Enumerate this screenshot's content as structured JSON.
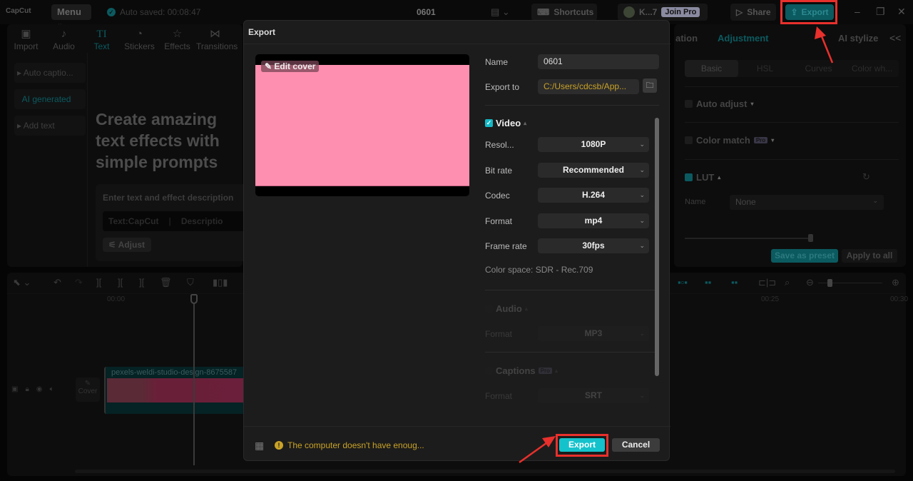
{
  "topbar": {
    "logo": "CapCut",
    "menu_label": "Menu",
    "autosave_text": "Auto saved: 00:08:47",
    "project_title": "0601",
    "shortcuts_label": "Shortcuts",
    "username": "K...7",
    "join_pro_label": "Join Pro",
    "share_label": "Share",
    "export_label": "Export"
  },
  "media_toolbar": {
    "items": [
      {
        "label": "Import",
        "icon": "import-icon"
      },
      {
        "label": "Audio",
        "icon": "audio-icon"
      },
      {
        "label": "Text",
        "icon": "text-icon",
        "active": true
      },
      {
        "label": "Stickers",
        "icon": "stickers-icon"
      },
      {
        "label": "Effects",
        "icon": "effects-icon"
      },
      {
        "label": "Transitions",
        "icon": "transitions-icon"
      }
    ]
  },
  "text_sidebar": {
    "items": [
      {
        "label": "Auto captio..."
      },
      {
        "label": "AI generated",
        "active": true
      },
      {
        "label": "Add text"
      }
    ]
  },
  "ai_text": {
    "hero_line1": "Create amazing",
    "hero_line2": "text effects with",
    "hero_line3": "simple prompts",
    "prompt_label": "Enter text and effect description",
    "text_placeholder": "Text:CapCut",
    "desc_placeholder": "Descriptio",
    "adjust_label": "Adjust"
  },
  "right_panel": {
    "tab_partial": "ation",
    "tab_adjustment": "Adjustment",
    "tab_ai_stylize": "AI stylize",
    "collapse_icon": "<<",
    "subtabs": [
      "Basic",
      "HSL",
      "Curves",
      "Color wh..."
    ],
    "auto_adjust_label": "Auto adjust",
    "color_match_label": "Color match",
    "lut_label": "LUT",
    "lut_name_label": "Name",
    "lut_name_value": "None",
    "save_preset_label": "Save as preset",
    "apply_all_label": "Apply to all",
    "pro_badge": "Pro"
  },
  "timeline": {
    "ruler_ticks": [
      "00:00",
      "00:25",
      "00:30"
    ],
    "clip_name": "pexels-weldi-studio-design-8675587",
    "cover_label": "Cover"
  },
  "export_dialog": {
    "title": "Export",
    "edit_cover_label": "Edit cover",
    "name_label": "Name",
    "name_value": "0601",
    "export_to_label": "Export to",
    "export_to_value": "C:/Users/cdcsb/App...",
    "video_section": "Video",
    "video_enabled": true,
    "resolution_label": "Resol...",
    "resolution_value": "1080P",
    "bitrate_label": "Bit rate",
    "bitrate_value": "Recommended",
    "codec_label": "Codec",
    "codec_value": "H.264",
    "format_label": "Format",
    "format_value": "mp4",
    "framerate_label": "Frame rate",
    "framerate_value": "30fps",
    "color_space": "Color space: SDR - Rec.709",
    "audio_section": "Audio",
    "audio_enabled": false,
    "audio_format_label": "Format",
    "audio_format_value": "MP3",
    "captions_section": "Captions",
    "captions_enabled": false,
    "captions_pro_badge": "Pro",
    "captions_format_label": "Format",
    "captions_format_value": "SRT",
    "warning_text": "The computer doesn't have enoug...",
    "export_label": "Export",
    "cancel_label": "Cancel"
  },
  "colors": {
    "accent": "#14c2cc",
    "annotation": "#e8302c",
    "preview_fill": "#fe8fb0",
    "warning": "#c9a227"
  }
}
